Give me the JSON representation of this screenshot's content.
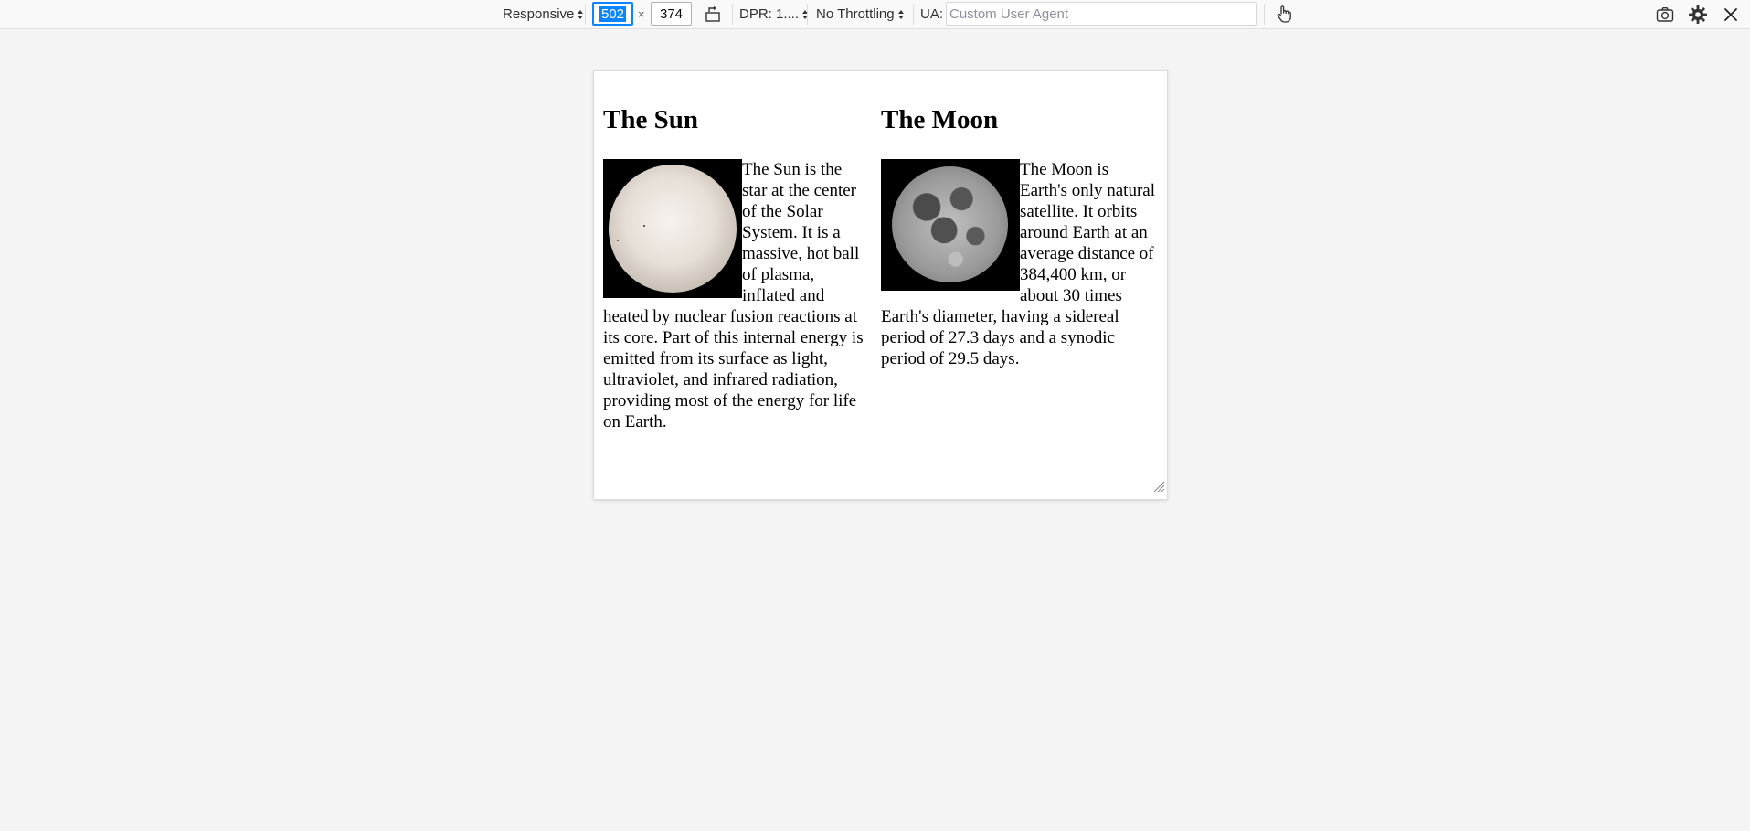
{
  "toolbar": {
    "device_label": "Responsive",
    "width_value": "502",
    "times_sign": "×",
    "height_value": "374",
    "dpr_label": "DPR: 1....",
    "throttling_label": "No Throttling",
    "ua_label": "UA:",
    "ua_placeholder": "Custom User Agent",
    "icons": [
      "rotate-icon",
      "touch-hand-icon",
      "screenshot-camera-icon",
      "settings-gear-icon",
      "close-icon"
    ]
  },
  "viewport": {
    "sun": {
      "heading": "The Sun",
      "image_alt": "sun-image",
      "text": "The Sun is the star at the center of the Solar System. It is a massive, hot ball of plasma, inflated and heated by nuclear fusion reactions at its core. Part of this internal energy is emitted from its surface as light, ultraviolet, and infrared radiation, providing most of the energy for life on Earth."
    },
    "moon": {
      "heading": "The Moon",
      "image_alt": "moon-image",
      "text": "The Moon is Earth's only natural satellite. It orbits around Earth at an average distance of 384,400 km, or about 30 times Earth's diameter, having a sidereal period of 27.3 days and a synodic period of 29.5 days."
    }
  },
  "colors": {
    "accent": "#0a84ff",
    "page_background": "#f4f4f4",
    "toolbar_background": "#f9f9fa"
  }
}
